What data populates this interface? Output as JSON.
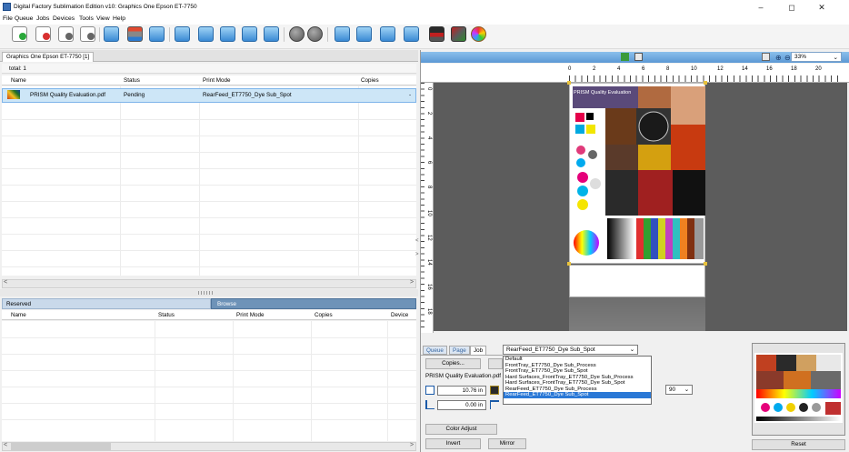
{
  "window": {
    "title": "Digital Factory Sublimation Edition v10: Graphics One Epson ET-7750",
    "minimize": "–",
    "maximize": "◻",
    "close": "✕"
  },
  "menu": [
    "File",
    "Queue",
    "Jobs",
    "Devices",
    "Tools",
    "View",
    "Help"
  ],
  "toolbar_icons": [
    "add-doc-icon",
    "remove-doc-icon",
    "doc-up-icon",
    "doc-down-icon",
    "queue-print-icon",
    "printer-icon",
    "monitor-icon",
    "move-up-icon",
    "move-left-icon",
    "move-right-icon",
    "move-in-icon",
    "move-top-icon",
    "pause-icon",
    "cancel-icon",
    "hold-icon",
    "release-icon",
    "queue-settings-icon",
    "queue-options-icon",
    "device-printer-icon",
    "device-calibrate-icon",
    "color-palette-icon"
  ],
  "queue": {
    "tab": "Graphics One Epson ET-7750 [1]",
    "total": "total: 1",
    "columns": [
      "Name",
      "Status",
      "Print Mode",
      "Copies"
    ],
    "jobs": [
      {
        "name": "PRISM Quality Evaluation.pdf",
        "status": "Pending",
        "print_mode": "RearFeed_ET7750_Dye Sub_Spot",
        "copies": "-"
      }
    ]
  },
  "lower": {
    "tabs": [
      "Reserved",
      "Browse"
    ],
    "columns": [
      "Name",
      "Status",
      "Print Mode",
      "Copies",
      "Device"
    ]
  },
  "preview": {
    "zoom": "33%",
    "ruler_top": [
      "0",
      "2",
      "4",
      "6",
      "8",
      "10",
      "12",
      "14",
      "16",
      "18",
      "20"
    ],
    "ruler_left": [
      "0",
      "2",
      "4",
      "6",
      "8",
      "10",
      "12",
      "14",
      "16",
      "18"
    ],
    "page_label": "PRISM Quality Evaluation"
  },
  "job_panel": {
    "tabs": [
      "Queue",
      "Page",
      "Job"
    ],
    "copies_button": "Copies...",
    "filename": "PRISM Quality Evaluation.pdf",
    "width": "10.76 in",
    "offset": "0.00 in",
    "print_mode_selected": "RearFeed_ET7750_Dye Sub_Spot",
    "print_mode_options": [
      "Default",
      "FrontTray_ET7750_Dye Sub_Process",
      "FrontTray_ET7750_Dye Sub_Spot",
      "Hard Surfaces_FrontTray_ET7750_Dye Sub_Process",
      "Hard Surfaces_FrontTray_ET7750_Dye Sub_Spot",
      "RearFeed_ET7750_Dye Sub_Process",
      "RearFeed_ET7750_Dye Sub_Spot"
    ],
    "rotation": "90",
    "color_adjust": "Color Adjust",
    "invert": "Invert",
    "mirror": "Mirror",
    "reset": "Reset"
  }
}
